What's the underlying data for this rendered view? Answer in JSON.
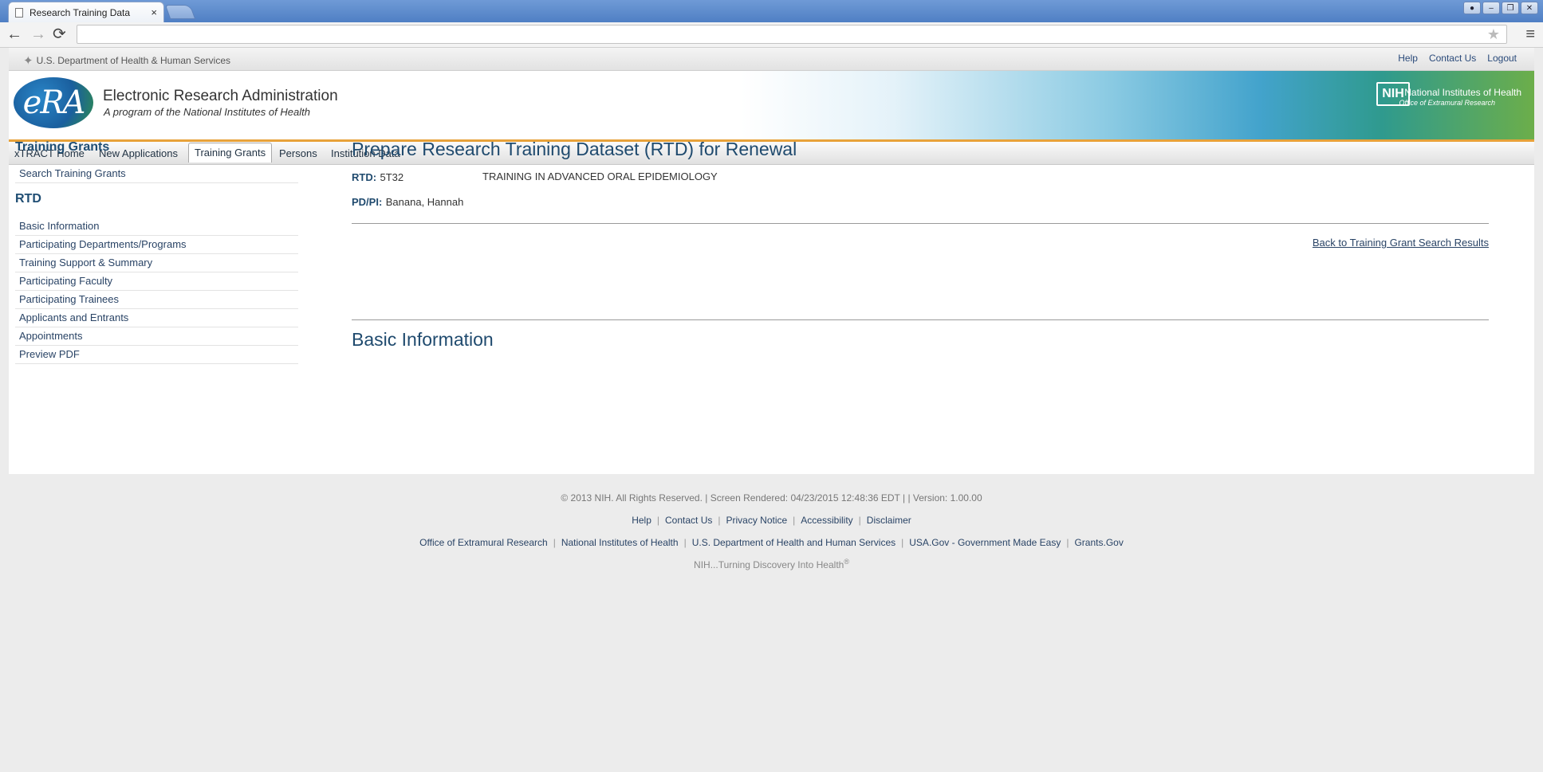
{
  "browser": {
    "tab_title": "Research Training Data",
    "tab_close": "×",
    "back_icon": "←",
    "forward_icon": "→",
    "reload_icon": "⟳",
    "star_icon": "★",
    "menu_icon": "≡",
    "address_value": ""
  },
  "hhs": {
    "label": "U.S. Department of Health & Human Services"
  },
  "utility_links": {
    "help": "Help",
    "contact": "Contact Us",
    "logout": "Logout"
  },
  "banner": {
    "logo_text": "eRA",
    "title": "Electronic Research Administration",
    "subtitle": "A program of the National Institutes of Health",
    "nih_logo": "NIH",
    "nih_title": "National Institutes of Health",
    "nih_subtitle": "Office of Extramural Research"
  },
  "nav_tabs": [
    "xTRACT Home",
    "New Applications",
    "Training Grants",
    "Persons",
    "Institution Data"
  ],
  "sidebar": {
    "section1_title": "Training Grants",
    "section1_items": [
      "Search Training Grants"
    ],
    "section2_title": "RTD",
    "section2_items": [
      "Basic Information",
      "Participating Departments/Programs",
      "Training Support & Summary",
      "Participating Faculty",
      "Participating Trainees",
      "Applicants and Entrants",
      "Appointments",
      "Preview PDF"
    ]
  },
  "main": {
    "title": "Prepare Research Training Dataset (RTD) for Renewal",
    "rtd_label": "RTD:",
    "rtd_value": "5T32",
    "rtd_title": "TRAINING IN ADVANCED ORAL EPIDEMIOLOGY",
    "pi_label": "PD/PI:",
    "pi_value": "Banana, Hannah",
    "back_link": "Back to Training Grant Search Results",
    "section_title": "Basic Information"
  },
  "footer": {
    "copyright": "© 2013 NIH. All Rights Reserved. | Screen Rendered: 04/23/2015 12:48:36 EDT | | Version: 1.00.00",
    "links_row1": [
      "Help",
      "Contact Us",
      "Privacy Notice",
      "Accessibility",
      "Disclaimer"
    ],
    "links_row2": [
      "Office of Extramural Research",
      "National Institutes of Health",
      "U.S. Department of Health and Human Services",
      "USA.Gov - Government Made Easy",
      "Grants.Gov"
    ],
    "tagline": "NIH...Turning Discovery Into Health",
    "tagline_sup": "®"
  }
}
